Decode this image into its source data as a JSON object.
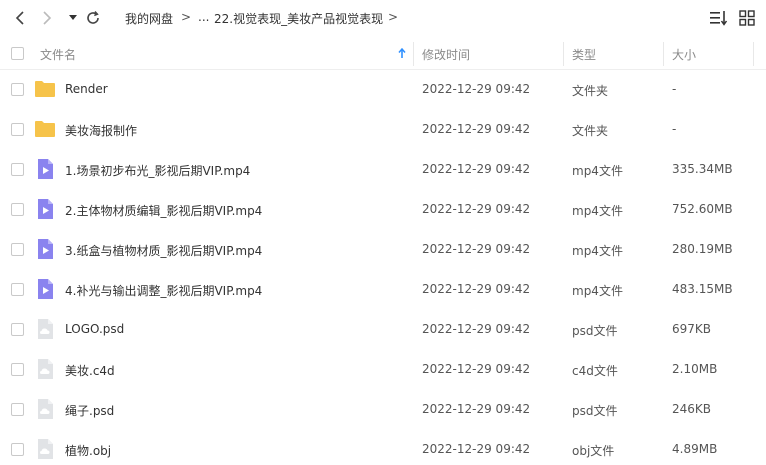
{
  "toolbar": {
    "breadcrumb": {
      "root": "我的网盘",
      "sep1": ">",
      "ellipsis": "...",
      "current": "22.视觉表现_美妆产品视觉表现",
      "sep2": ">"
    }
  },
  "columns": {
    "name": "文件名",
    "modified": "修改时间",
    "type": "类型",
    "size": "大小"
  },
  "files": [
    {
      "name": "Render",
      "modified": "2022-12-29 09:42",
      "type": "文件夹",
      "size": "-",
      "icon": "folder-icon"
    },
    {
      "name": "美妆海报制作",
      "modified": "2022-12-29 09:42",
      "type": "文件夹",
      "size": "-",
      "icon": "folder-icon"
    },
    {
      "name": "1.场景初步布光_影视后期VIP.mp4",
      "modified": "2022-12-29 09:42",
      "type": "mp4文件",
      "size": "335.34MB",
      "icon": "video-file-icon"
    },
    {
      "name": "2.主体物材质编辑_影视后期VIP.mp4",
      "modified": "2022-12-29 09:42",
      "type": "mp4文件",
      "size": "752.60MB",
      "icon": "video-file-icon"
    },
    {
      "name": "3.纸盒与植物材质_影视后期VIP.mp4",
      "modified": "2022-12-29 09:42",
      "type": "mp4文件",
      "size": "280.19MB",
      "icon": "video-file-icon"
    },
    {
      "name": "4.补光与输出调整_影视后期VIP.mp4",
      "modified": "2022-12-29 09:42",
      "type": "mp4文件",
      "size": "483.15MB",
      "icon": "video-file-icon"
    },
    {
      "name": "LOGO.psd",
      "modified": "2022-12-29 09:42",
      "type": "psd文件",
      "size": "697KB",
      "icon": "cloud-file-icon"
    },
    {
      "name": "美妆.c4d",
      "modified": "2022-12-29 09:42",
      "type": "c4d文件",
      "size": "2.10MB",
      "icon": "cloud-file-icon"
    },
    {
      "name": "绳子.psd",
      "modified": "2022-12-29 09:42",
      "type": "psd文件",
      "size": "246KB",
      "icon": "cloud-file-icon"
    },
    {
      "name": "植物.obj",
      "modified": "2022-12-29 09:42",
      "type": "obj文件",
      "size": "4.89MB",
      "icon": "cloud-file-icon"
    }
  ],
  "colors": {
    "folder": "#f6c34a",
    "video": "#8a83ef",
    "cloud_file": "#e1e3e6",
    "sort_arrow": "#2e8fff"
  }
}
